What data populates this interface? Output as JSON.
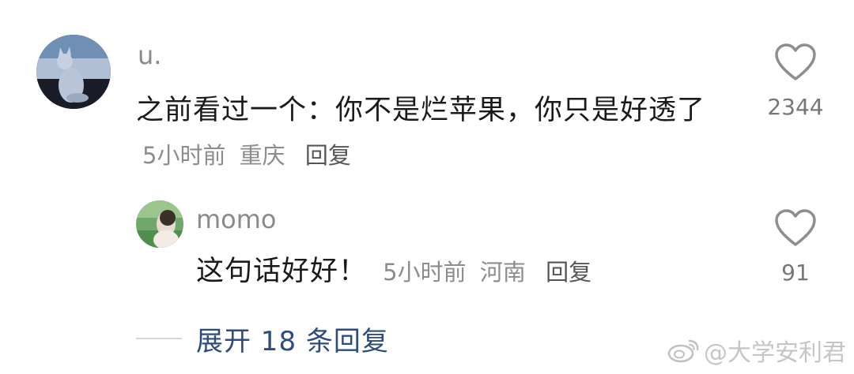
{
  "comment": {
    "username": "u.",
    "text": "之前看过一个：你不是烂苹果，你只是好透了",
    "time": "5小时前",
    "location": "重庆",
    "reply_label": "回复",
    "like_count": "2344"
  },
  "reply": {
    "username": "momo",
    "text": "这句话好好！",
    "time": "5小时前",
    "location": "河南",
    "reply_label": "回复",
    "like_count": "91"
  },
  "expand": {
    "label": "展开 18 条回复"
  },
  "watermark": {
    "text": "@大学安利君"
  },
  "icons": {
    "like": "heart-outline-icon",
    "watermark": "weibo-logo-icon"
  }
}
